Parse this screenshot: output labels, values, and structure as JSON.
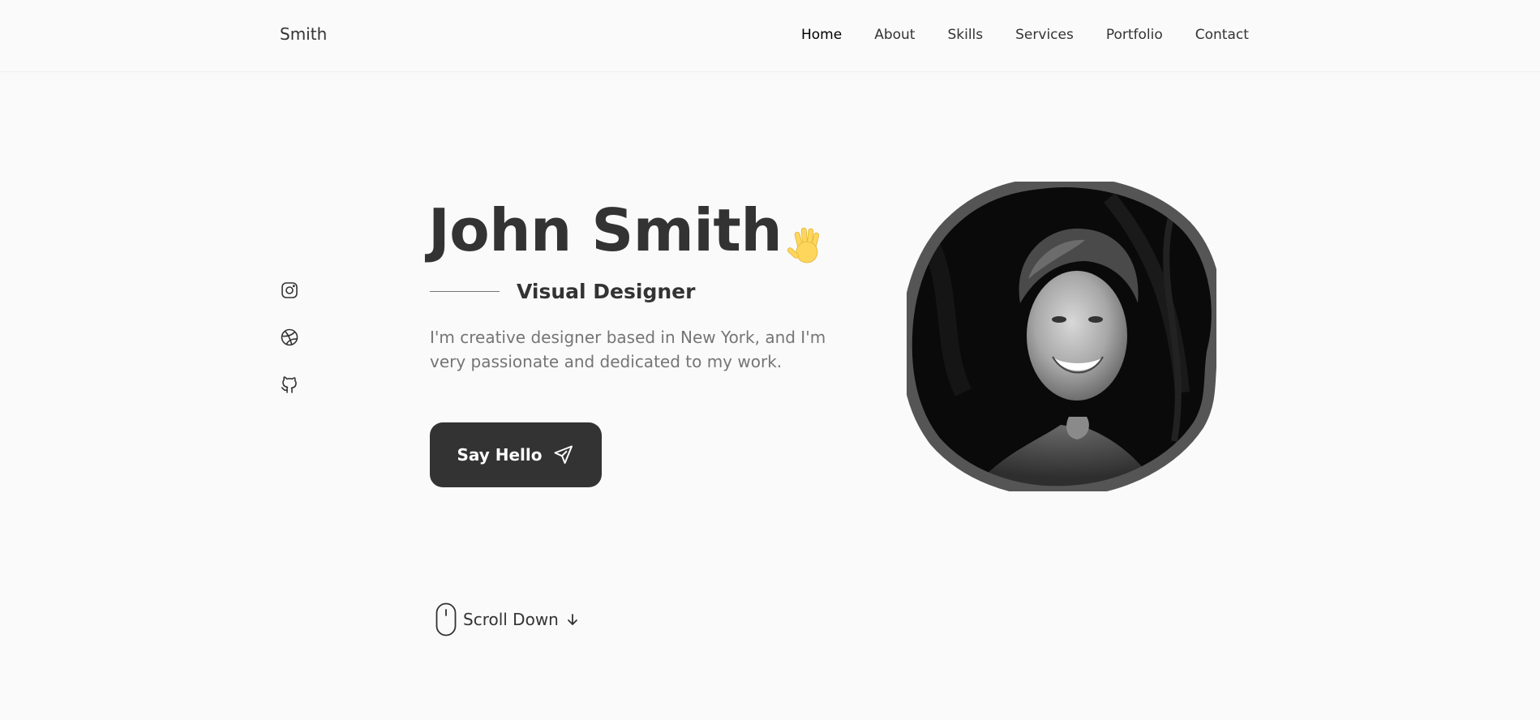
{
  "header": {
    "logo": "Smith",
    "nav": [
      {
        "label": "Home",
        "active": true
      },
      {
        "label": "About",
        "active": false
      },
      {
        "label": "Skills",
        "active": false
      },
      {
        "label": "Services",
        "active": false
      },
      {
        "label": "Portfolio",
        "active": false
      },
      {
        "label": "Contact",
        "active": false
      }
    ]
  },
  "social": {
    "items": [
      {
        "icon": "instagram-icon"
      },
      {
        "icon": "dribbble-icon"
      },
      {
        "icon": "github-icon"
      }
    ]
  },
  "hero": {
    "name": "John Smith",
    "wave_icon": "waving-hand-icon",
    "subtitle": "Visual Designer",
    "description": "I'm creative designer based in New York, and I'm very passionate and dedicated to my work.",
    "cta_label": "Say Hello",
    "cta_icon": "send-icon"
  },
  "scroll": {
    "label": "Scroll Down",
    "mouse_icon": "mouse-icon",
    "arrow_icon": "arrow-down-icon"
  },
  "colors": {
    "background": "#fafafa",
    "text": "#333333",
    "muted": "#757575",
    "button": "#333333",
    "wave": "#ffd65c"
  }
}
